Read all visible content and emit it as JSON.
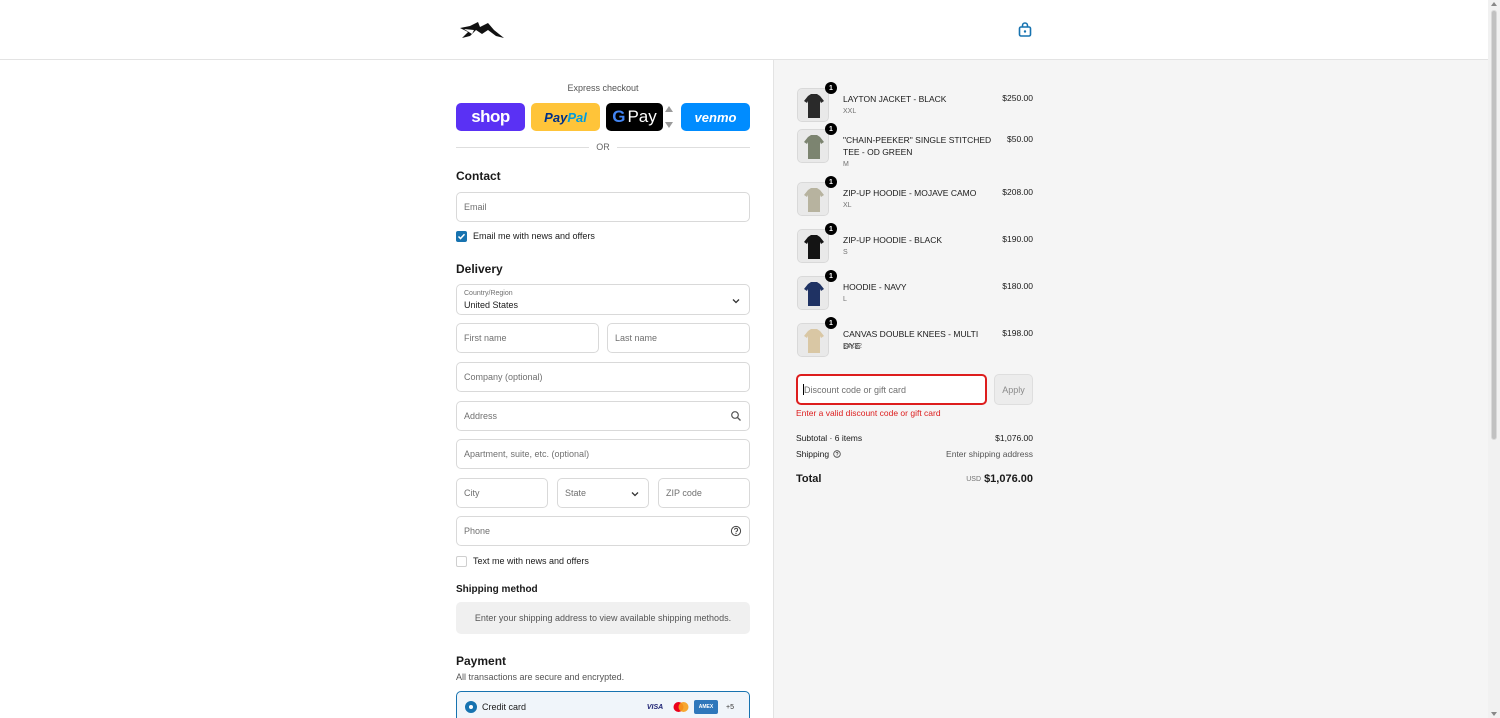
{
  "header": {
    "logo_alt": "store-logo",
    "cart_icon": "shopping-bag-icon"
  },
  "express": {
    "title": "Express checkout",
    "shop_label": "shop",
    "paypal_label_a": "Pay",
    "paypal_label_b": "Pal",
    "gpay_label": "Pay",
    "venmo_label": "venmo",
    "or_label": "OR"
  },
  "contact": {
    "title": "Contact",
    "email_placeholder": "Email",
    "newsletter_label": "Email me with news and offers",
    "newsletter_checked": true
  },
  "delivery": {
    "title": "Delivery",
    "country_label": "Country/Region",
    "country_value": "United States",
    "first_name_placeholder": "First name",
    "last_name_placeholder": "Last name",
    "company_placeholder": "Company (optional)",
    "address_placeholder": "Address",
    "apartment_placeholder": "Apartment, suite, etc. (optional)",
    "city_placeholder": "City",
    "state_placeholder": "State",
    "zip_placeholder": "ZIP code",
    "phone_placeholder": "Phone",
    "sms_label": "Text me with news and offers",
    "sms_checked": false
  },
  "shipping_method": {
    "title": "Shipping method",
    "message": "Enter your shipping address to view available shipping methods."
  },
  "payment": {
    "title": "Payment",
    "subtitle": "All transactions are secure and encrypted.",
    "method_label": "Credit card",
    "cards": [
      "VISA",
      "mastercard",
      "AMEX"
    ],
    "more_cards": "+5"
  },
  "order": {
    "items": [
      {
        "name": "LAYTON JACKET - BLACK",
        "variant": "XXL",
        "price": "$250.00",
        "qty": "1",
        "thumb_color": "#2a2a2a"
      },
      {
        "name": "\"CHAIN-PEEKER\" SINGLE STITCHED TEE - OD GREEN",
        "variant": "M",
        "price": "$50.00",
        "qty": "1",
        "thumb_color": "#7c8470"
      },
      {
        "name": "ZIP-UP HOODIE - MOJAVE CAMO",
        "variant": "XL",
        "price": "$208.00",
        "qty": "1",
        "thumb_color": "#b7b39f"
      },
      {
        "name": "ZIP-UP HOODIE - BLACK",
        "variant": "S",
        "price": "$190.00",
        "qty": "1",
        "thumb_color": "#141414"
      },
      {
        "name": "HOODIE - NAVY",
        "variant": "L",
        "price": "$180.00",
        "qty": "1",
        "thumb_color": "#1f3263"
      },
      {
        "name": "CANVAS DOUBLE KNEES - MULTI DYE",
        "variant": "34x32",
        "price": "$198.00",
        "qty": "1",
        "thumb_color": "#d9c7a4"
      }
    ],
    "discount_placeholder": "Discount code or gift card",
    "apply_label": "Apply",
    "discount_error": "Enter a valid discount code or gift card",
    "subtotal_label": "Subtotal · 6 items",
    "subtotal_value": "$1,076.00",
    "shipping_label": "Shipping",
    "shipping_value": "Enter shipping address",
    "total_label": "Total",
    "currency": "USD",
    "total_value": "$1,076.00"
  },
  "colors": {
    "accent": "#1773b0",
    "error": "#dd1d1d",
    "shop": "#5a31f4",
    "paypal": "#ffc439",
    "venmo": "#008cff"
  }
}
